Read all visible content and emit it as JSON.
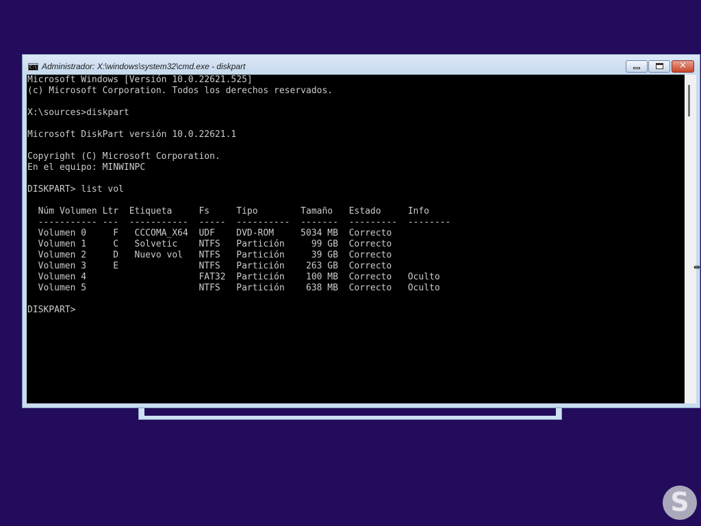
{
  "window": {
    "title": "Administrador: X:\\windows\\system32\\cmd.exe - diskpart"
  },
  "console": {
    "lines": [
      "Microsoft Windows [Versión 10.0.22621.525]",
      "(c) Microsoft Corporation. Todos los derechos reservados.",
      "",
      "X:\\sources>diskpart",
      "",
      "Microsoft DiskPart versión 10.0.22621.1",
      "",
      "Copyright (C) Microsoft Corporation.",
      "En el equipo: MINWINPC",
      "",
      "DISKPART> list vol",
      "",
      "  Núm Volumen Ltr  Etiqueta     Fs     Tipo        Tamaño   Estado     Info",
      "  ----------- ---  -----------  -----  ----------  -------  ---------  --------",
      "  Volumen 0     F   CCCOMA_X64  UDF    DVD-ROM     5034 MB  Correcto",
      "  Volumen 1     C   Solvetic    NTFS   Partición     99 GB  Correcto",
      "  Volumen 2     D   Nuevo vol   NTFS   Partición     39 GB  Correcto",
      "  Volumen 3     E               NTFS   Partición    263 GB  Correcto",
      "  Volumen 4                     FAT32  Partición    100 MB  Correcto   Oculto",
      "  Volumen 5                     NTFS   Partición    638 MB  Correcto   Oculto",
      "",
      "DISKPART>"
    ]
  },
  "icons": {
    "title": "cmd-icon",
    "minimize": "minimize-icon",
    "maximize": "maximize-icon",
    "close": "close-icon",
    "cursor": "resize-cursor-icon",
    "logo": "solvetic-logo-icon"
  },
  "colors": {
    "desktop": "#220c5b",
    "console_bg": "#000000",
    "console_text": "#cccccc",
    "close_button": "#c9452b"
  }
}
